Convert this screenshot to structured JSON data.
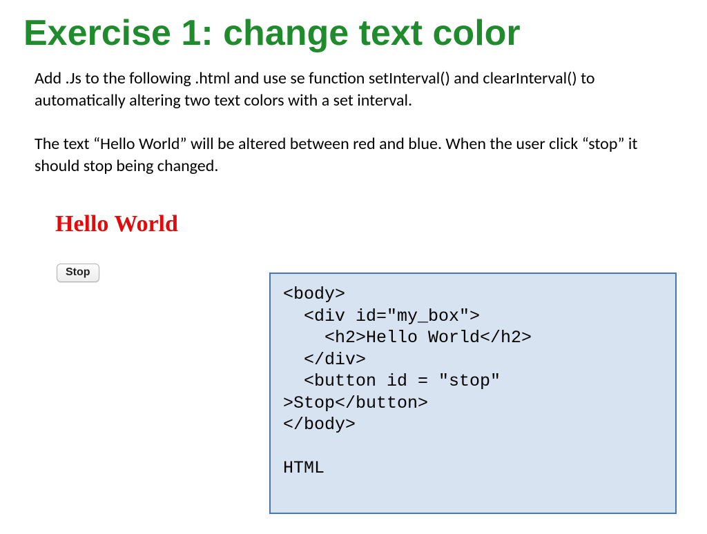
{
  "title": "Exercise 1: change text color",
  "description": {
    "paragraph1": "Add .Js to the following .html  and use se function setInterval() and clearInterval() to automatically altering two text colors with a set interval.",
    "paragraph2": "The text “Hello World” will be altered between red and blue. When the user click “stop” it should stop being changed."
  },
  "demo": {
    "hello_label": "Hello World",
    "stop_label": "Stop"
  },
  "code_block": "<body>\n  <div id=\"my_box\">\n    <h2>Hello World</h2>\n  </div>\n  <button id = \"stop\" \n>Stop</button>\n</body>\n\nHTML"
}
